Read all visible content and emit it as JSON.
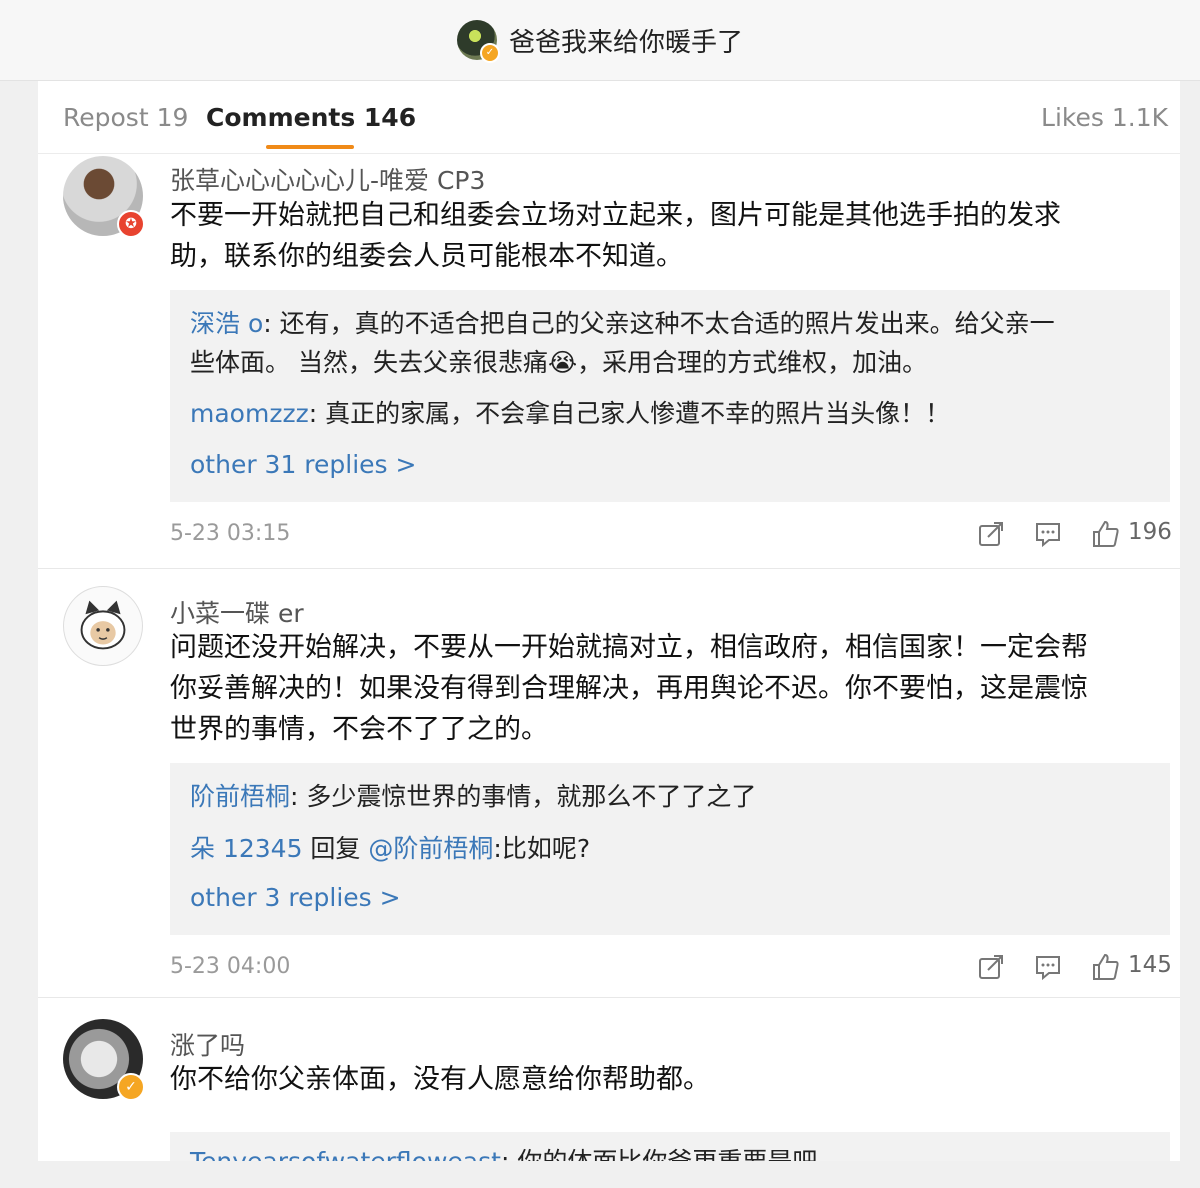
{
  "header": {
    "title": "爸爸我来给你暖手了"
  },
  "tabs": {
    "repost": "Repost 19",
    "comments": "Comments 146",
    "likes": "Likes 1.1K"
  },
  "comments": [
    {
      "username": "张草心心心心心儿-唯爱 CP3",
      "text_line1": "不要一开始就把自己和组委会立场对立起来，图片可能是其他选手拍的发求",
      "text_line2": "助，联系你的组委会人员可能根本不知道。",
      "replies": [
        {
          "name": "深浩 o",
          "line1": ": 还有，真的不适合把自己的父亲这种不太合适的照片发出来。给父亲一",
          "line2": "些体面。 当然，失去父亲很悲痛😭，采用合理的方式维权，加油。"
        },
        {
          "name": "maomzzz",
          "line1": ": 真正的家属，不会拿自己家人惨遭不幸的照片当头像！！"
        }
      ],
      "more": "other 31 replies >",
      "date": "5-23 03:15",
      "likes": "196"
    },
    {
      "username": "小菜一碟 er",
      "text_line1": "问题还没开始解决，不要从一开始就搞对立，相信政府，相信国家！一定会帮",
      "text_line2": "你妥善解决的！如果没有得到合理解决，再用舆论不迟。你不要怕，这是震惊",
      "text_line3": "世界的事情，不会不了了之的。",
      "replies": [
        {
          "name": "阶前梧桐",
          "line1": ": 多少震惊世界的事情，就那么不了了之了"
        },
        {
          "name": "朵 12345",
          "mid": " 回复 ",
          "mention": "@阶前梧桐",
          "line1": ":比如呢?"
        }
      ],
      "more": "other 3 replies >",
      "date": "5-23 04:00",
      "likes": "145"
    },
    {
      "username": "涨了吗",
      "text_line1": "你不给你父亲体面，没有人愿意给你帮助都。",
      "replies": [
        {
          "name": "Tenyearsofwaterfloweast",
          "line1": ": 你的体面比你爸更重要是吧"
        }
      ]
    }
  ],
  "colors": {
    "accent": "#f08a18",
    "link": "#3b78b8",
    "vip": "#f5a623",
    "red_badge": "#e8432f"
  }
}
